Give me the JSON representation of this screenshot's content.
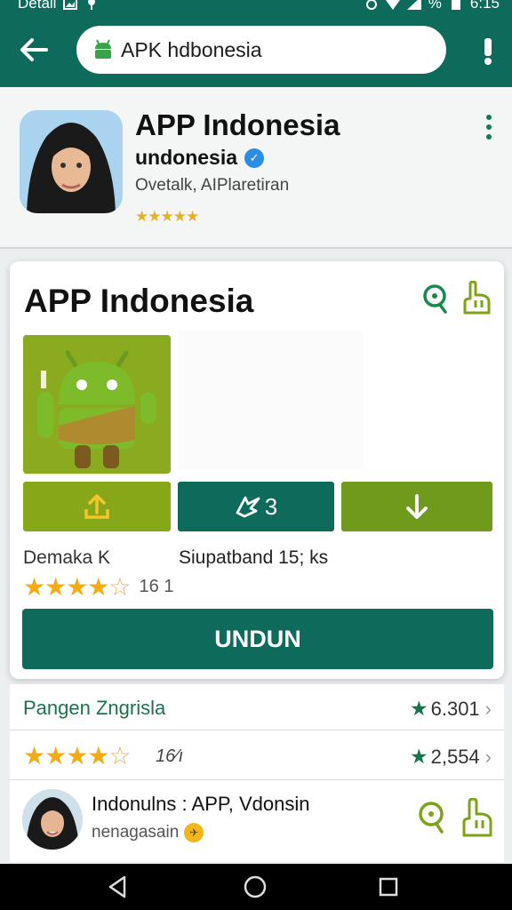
{
  "status_bar": {
    "left_label": "Detail",
    "time": "6:15"
  },
  "search": {
    "query": "APK hdbonesia"
  },
  "header": {
    "title": "APP Indonesia",
    "subtitle": "undonesia",
    "developer": "Ovetalk, AIPlaretiran",
    "rating_stars": "★★★★★"
  },
  "card": {
    "title": "APP Indonesia",
    "share_badge": "3",
    "info_left": "Demaka K",
    "info_right": "Siupatband 15; ks",
    "rating_stars_full": "★★★★",
    "rating_stars_empty": "☆",
    "rating_count": "16 1",
    "download_label": "UNDUN"
  },
  "list": {
    "row1": {
      "title": "Pangen Zngrisla",
      "score": "6.301"
    },
    "row2": {
      "stars_full": "★★★★",
      "stars_empty": "☆",
      "count": "16⁄ı",
      "score": "2,554"
    },
    "row3": {
      "title": "Indonulns : APP, Vdonsin",
      "subtitle": "nenagasain"
    }
  },
  "colors": {
    "primary": "#0e6b5c",
    "lime": "#86a818",
    "star": "#f1ac14",
    "accent_green": "#17744d"
  },
  "icons": [
    "back-arrow-icon",
    "android-icon",
    "alert-icon",
    "more-vert-icon",
    "search-circle-icon",
    "hand-pointer-icon",
    "upload-icon",
    "share-icon",
    "download-arrow-icon",
    "verified-icon",
    "star-icon",
    "chevron-right-icon",
    "coin-icon",
    "nav-back-icon",
    "nav-home-icon",
    "nav-recents-icon"
  ]
}
